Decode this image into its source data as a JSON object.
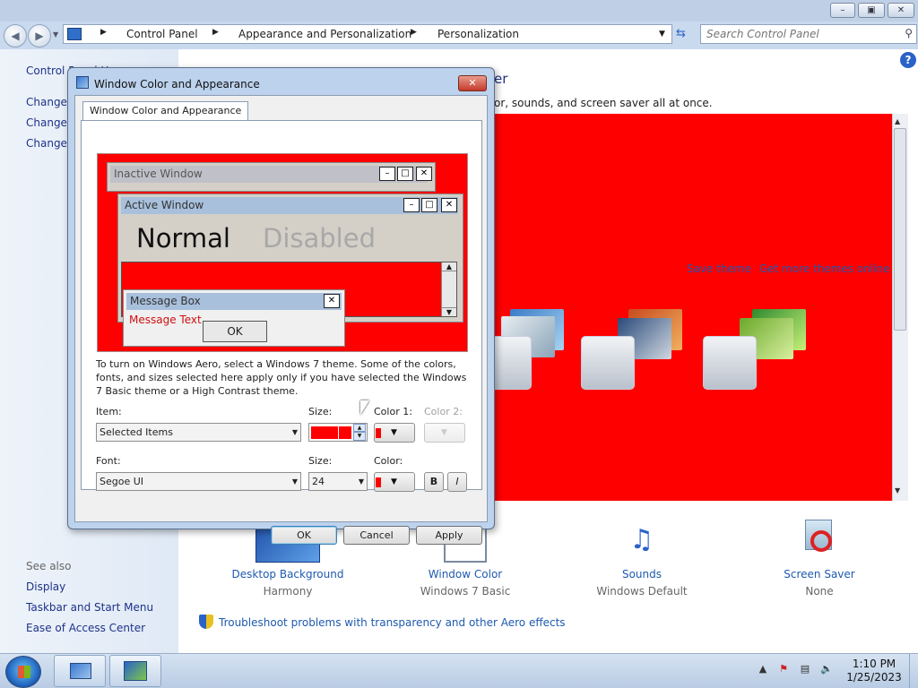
{
  "window": {
    "min_label": "–",
    "max_label": "▣",
    "close_label": "✕"
  },
  "address": {
    "crumbs": [
      "Control Panel",
      "Appearance and Personalization",
      "Personalization"
    ],
    "search_placeholder": "Search Control Panel"
  },
  "sidebar": {
    "control_panel_home": "Control Panel Home",
    "links": [
      "Change desktop icons",
      "Change mouse pointers",
      "Change your account picture"
    ],
    "see_also": "See also",
    "see_also_links": [
      "Display",
      "Taskbar and Start Menu",
      "Ease of Access Center"
    ]
  },
  "main": {
    "heading_fragment": "er",
    "subtitle_fragment": "or, sounds, and screen saver all at once.",
    "save_theme": "Save theme",
    "get_more_themes": "Get more themes online",
    "troubleshoot_link": "Troubleshoot problems with transparency and other Aero effects",
    "items": [
      {
        "title": "Desktop Background",
        "sub": "Harmony"
      },
      {
        "title": "Window Color",
        "sub": "Windows 7 Basic"
      },
      {
        "title": "Sounds",
        "sub": "Windows Default"
      },
      {
        "title": "Screen Saver",
        "sub": "None"
      }
    ]
  },
  "dialog": {
    "title": "Window Color and Appearance",
    "tab": "Window Color and Appearance",
    "preview": {
      "inactive_title": "Inactive Window",
      "active_title": "Active Window",
      "normal": "Normal",
      "disabled": "Disabled",
      "msgbox_title": "Message Box",
      "msgbox_text": "Message Text",
      "msgbox_ok": "OK"
    },
    "info": "To turn on Windows Aero, select a Windows 7 theme.  Some of the colors, fonts, and sizes selected here apply only if you have selected the Windows 7 Basic theme or a High Contrast theme.",
    "item_label": "Item:",
    "item_value": "Selected Items",
    "size_label": "Size:",
    "color1_label": "Color 1:",
    "color2_label": "Color 2:",
    "font_label": "Font:",
    "font_value": "Segoe UI",
    "font_size_label": "Size:",
    "font_size_value": "24",
    "font_color_label": "Color:",
    "bold": "B",
    "italic": "I",
    "ok": "OK",
    "cancel": "Cancel",
    "apply": "Apply"
  },
  "taskbar": {
    "time": "1:10 PM",
    "date": "1/25/2023"
  },
  "colors": {
    "selected_color": "#ff0000",
    "link": "#1e5aaf",
    "sidebar_link": "#1e3287"
  }
}
